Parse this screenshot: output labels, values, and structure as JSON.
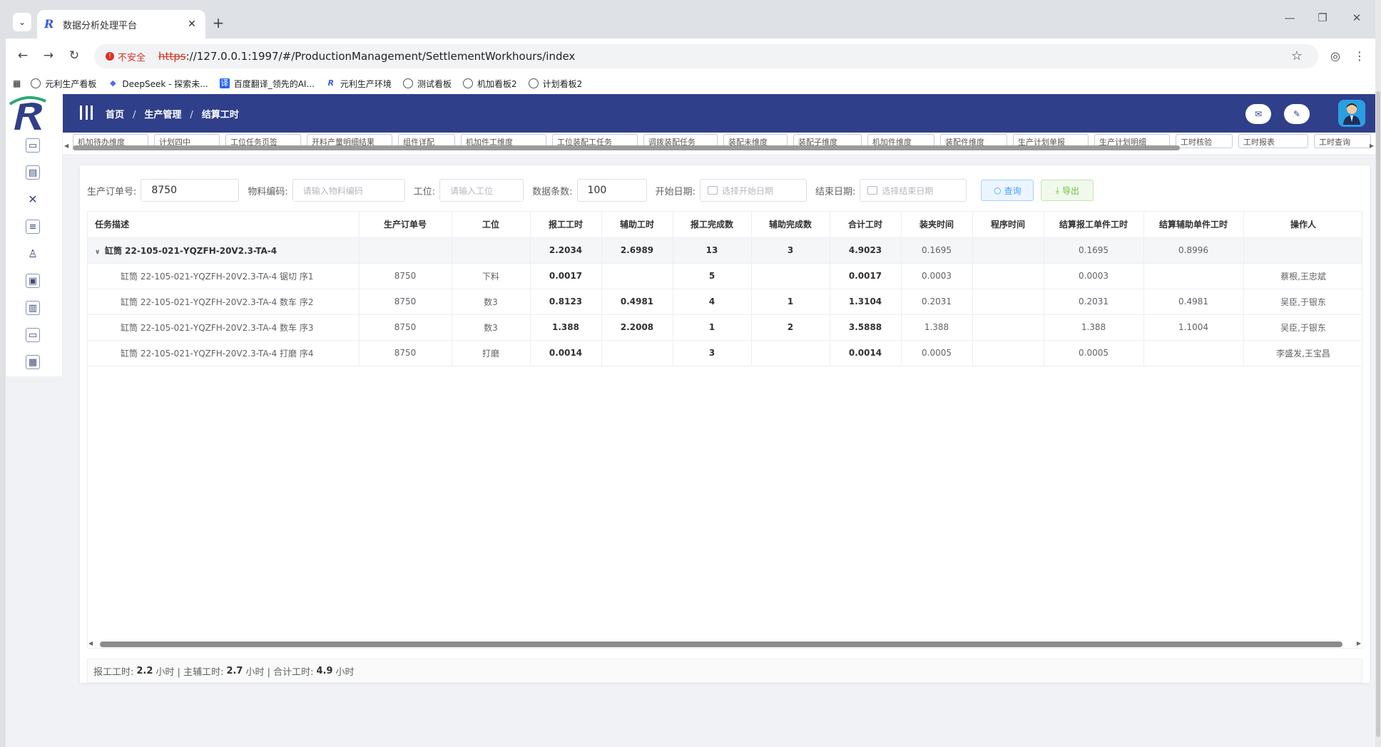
{
  "browser": {
    "tab_title": "数据分析处理平台",
    "security_label": "不安全",
    "url_scheme": "https",
    "url_rest": "://127.0.0.1:1997/#/ProductionManagement/SettlementWorkhours/index",
    "bookmarks": [
      "元利生产看板",
      "DeepSeek - 探索未...",
      "百度翻译_领先的AI...",
      "元利生产环境",
      "测试看板",
      "机加看板2",
      "计划看板2"
    ]
  },
  "header": {
    "breadcrumb": [
      "首页",
      "生产管理",
      "结算工时"
    ]
  },
  "tags": [
    "机加待办维度",
    "计划四中",
    "工位任务页签",
    "开料产量明细结果",
    "组件详配",
    "机加件工维度",
    "工位装配工任务",
    "调拨装配任务",
    "装配未维度",
    "装配子维度",
    "机加件维度",
    "装配件维度",
    "生产计划单报",
    "生产计划明细",
    "工时核验",
    "工时报表",
    "工时查询"
  ],
  "filters": {
    "order_label": "生产订单号:",
    "order_value": "8750",
    "material_label": "物料编码:",
    "material_placeholder": "请输入物料编码",
    "station_label": "工位:",
    "station_placeholder": "请输入工位",
    "count_label": "数据条数:",
    "count_value": "100",
    "start_label": "开始日期:",
    "start_placeholder": "选择开始日期",
    "end_label": "结束日期:",
    "end_placeholder": "选择结束日期",
    "query_label": "查询",
    "export_label": "导出"
  },
  "table": {
    "headers": [
      "任务描述",
      "生产订单号",
      "工位",
      "报工工时",
      "辅助工时",
      "报工完成数",
      "辅助完成数",
      "合计工时",
      "装夹时间",
      "程序时间",
      "结算报工单件工时",
      "结算辅助单件工时",
      "操作人"
    ],
    "parent": [
      "缸筒 22-105-021-YQZFH-20V2.3-TA-4",
      "",
      "",
      "2.2034",
      "2.6989",
      "13",
      "3",
      "4.9023",
      "0.1695",
      "",
      "0.1695",
      "0.8996",
      ""
    ],
    "rows": [
      [
        "缸筒 22-105-021-YQZFH-20V2.3-TA-4 锯切 序1",
        "8750",
        "下料",
        "0.0017",
        "",
        "5",
        "",
        "0.0017",
        "0.0003",
        "",
        "0.0003",
        "",
        "蔡根,王忠斌"
      ],
      [
        "缸筒 22-105-021-YQZFH-20V2.3-TA-4 数车 序2",
        "8750",
        "数3",
        "0.8123",
        "0.4981",
        "4",
        "1",
        "1.3104",
        "0.2031",
        "",
        "0.2031",
        "0.4981",
        "吴臣,于银东"
      ],
      [
        "缸筒 22-105-021-YQZFH-20V2.3-TA-4 数车 序3",
        "8750",
        "数3",
        "1.388",
        "2.2008",
        "1",
        "2",
        "3.5888",
        "1.388",
        "",
        "1.388",
        "1.1004",
        "吴臣,于银东"
      ],
      [
        "缸筒 22-105-021-YQZFH-20V2.3-TA-4 打磨 序4",
        "8750",
        "打磨",
        "0.0014",
        "",
        "3",
        "",
        "0.0014",
        "0.0005",
        "",
        "0.0005",
        "",
        "李盛发,王宝昌"
      ]
    ]
  },
  "summary": {
    "report_label": "报工工时:",
    "report_value": "2.2",
    "aux_label": "小时 | 主辅工时:",
    "aux_value": "2.7",
    "total_label": "小时 | 合计工时:",
    "total_value": "4.9",
    "unit": "小时"
  }
}
